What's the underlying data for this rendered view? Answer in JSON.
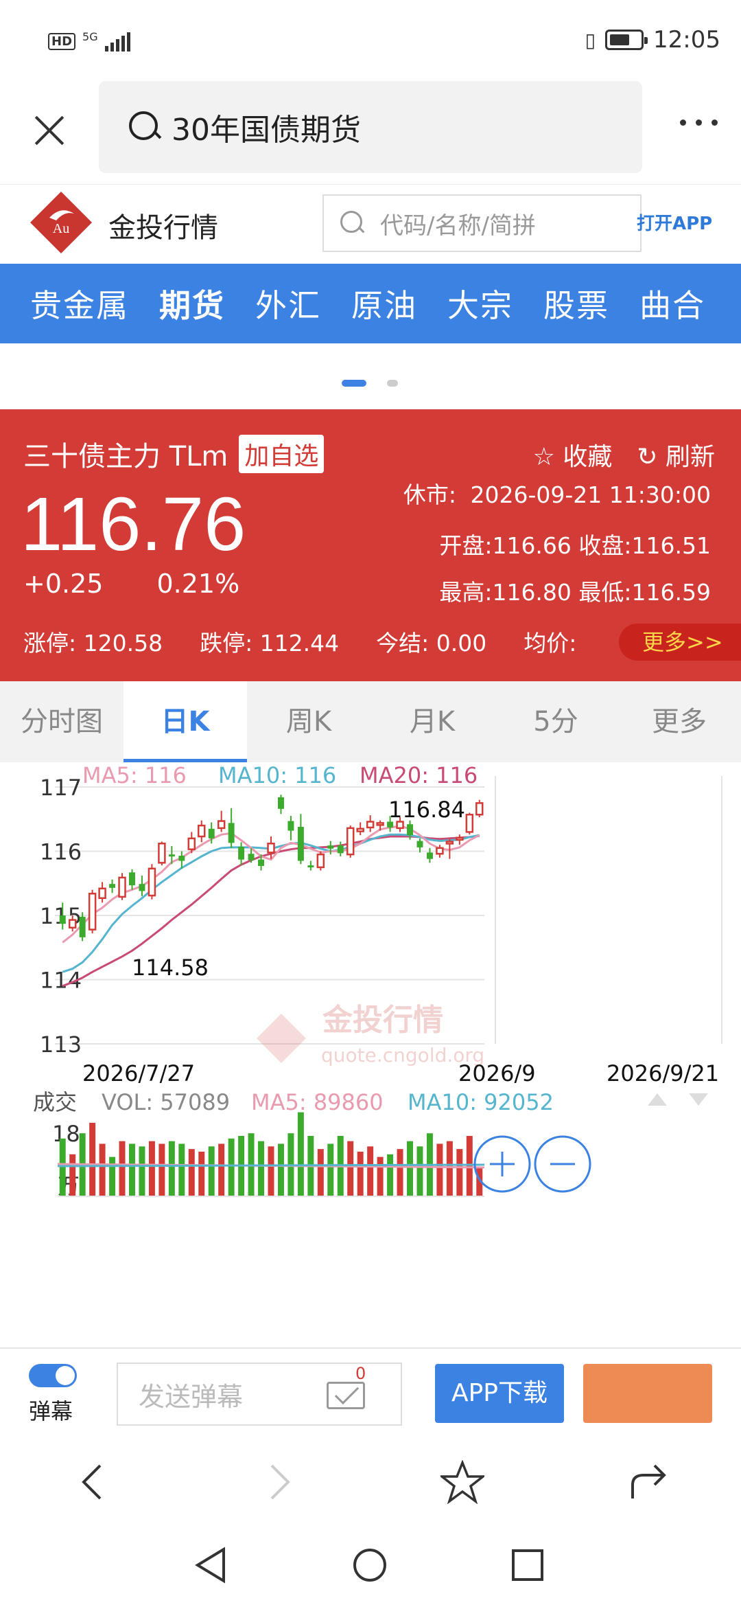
{
  "status_bar": {
    "hd": "HD",
    "network": "5G",
    "time": "12:05"
  },
  "browser": {
    "search_text": "30年国债期货"
  },
  "site": {
    "name": "金投行情",
    "logo_text": "Au",
    "search_placeholder": "代码/名称/简拼",
    "open_app": "打开APP"
  },
  "nav": [
    "贵金属",
    "期货",
    "外汇",
    "原油",
    "大宗",
    "股票",
    "曲合"
  ],
  "quote": {
    "name": "三十债主力 TLm",
    "add_watch": "加自选",
    "favorite": "收藏",
    "refresh": "刷新",
    "price": "116.76",
    "change": "+0.25",
    "change_pct": "0.21%",
    "status_label": "休市:",
    "status_time": "2026-09-21 11:30:00",
    "open_close": "开盘:116.66 收盘:116.51",
    "high_low": "最高:116.80 最低:116.59",
    "limit_up": "涨停: 120.58",
    "limit_down": "跌停: 112.44",
    "settle": "今结: 0.00",
    "avg": "均价:",
    "more": "更多>>"
  },
  "tabs": [
    "分时图",
    "日K",
    "周K",
    "月K",
    "5分",
    "更多"
  ],
  "colors": {
    "up": "#d23b36",
    "down": "#3cab2d",
    "ma5": "#ea9aaf",
    "ma10": "#55b5cf",
    "ma20": "#c94a72",
    "accent": "#3c82e3"
  },
  "chart_data": {
    "type": "candlestick",
    "ma_legend": [
      "MA5: 116",
      "MA10: 116",
      "MA20: 116"
    ],
    "y_ticks": [
      "117",
      "116",
      "115",
      "114",
      "113"
    ],
    "ylim": [
      113,
      117.1
    ],
    "x_labels": [
      "2026/7/27",
      "2026/9",
      "2026/9/21"
    ],
    "max_label": "116.84",
    "min_label": "114.58",
    "watermark_name": "金投行情",
    "watermark_url": "quote.cngold.org",
    "volume_legend": {
      "label": "成交",
      "vol": "VOL: 57089",
      "ma5": "MA5: 89860",
      "ma10": "MA10: 92052"
    },
    "volume_unit_top": "18",
    "volume_unit_bottom": "万",
    "candles": [
      [
        114.87,
        115.0,
        114.78,
        115.2,
        "down"
      ],
      [
        114.81,
        114.93,
        114.75,
        115.0,
        "up"
      ],
      [
        114.98,
        114.66,
        114.6,
        115.05,
        "down"
      ],
      [
        114.78,
        115.34,
        114.72,
        115.4,
        "up"
      ],
      [
        115.27,
        115.42,
        115.2,
        115.52,
        "up"
      ],
      [
        115.49,
        115.43,
        115.35,
        115.56,
        "down"
      ],
      [
        115.29,
        115.59,
        115.24,
        115.66,
        "up"
      ],
      [
        115.67,
        115.47,
        115.4,
        115.72,
        "down"
      ],
      [
        115.49,
        115.38,
        115.3,
        115.62,
        "down"
      ],
      [
        115.31,
        115.73,
        115.25,
        115.8,
        "up"
      ],
      [
        115.82,
        116.12,
        115.78,
        116.15,
        "up"
      ],
      [
        115.95,
        115.92,
        115.8,
        116.08,
        "down"
      ],
      [
        115.93,
        115.85,
        115.73,
        116.0,
        "down"
      ],
      [
        116.03,
        116.2,
        115.97,
        116.3,
        "up"
      ],
      [
        116.23,
        116.4,
        116.14,
        116.48,
        "up"
      ],
      [
        116.35,
        116.2,
        116.12,
        116.45,
        "down"
      ],
      [
        116.36,
        116.47,
        116.3,
        116.63,
        "up"
      ],
      [
        116.44,
        116.13,
        116.05,
        116.67,
        "down"
      ],
      [
        116.07,
        115.87,
        115.78,
        116.14,
        "down"
      ],
      [
        115.96,
        115.86,
        115.82,
        116.05,
        "down"
      ],
      [
        115.87,
        115.77,
        115.7,
        115.95,
        "down"
      ],
      [
        115.98,
        116.12,
        115.88,
        116.23,
        "up"
      ],
      [
        116.84,
        116.66,
        116.58,
        116.88,
        "down"
      ],
      [
        116.47,
        116.32,
        116.17,
        116.55,
        "down"
      ],
      [
        116.38,
        115.85,
        115.8,
        116.58,
        "down"
      ],
      [
        115.78,
        115.76,
        115.7,
        115.85,
        "down"
      ],
      [
        115.75,
        115.95,
        115.7,
        116.0,
        "up"
      ],
      [
        116.09,
        116.04,
        115.95,
        116.16,
        "down"
      ],
      [
        116.09,
        115.97,
        115.92,
        116.15,
        "down"
      ],
      [
        115.95,
        116.36,
        115.9,
        116.4,
        "up"
      ],
      [
        116.31,
        116.35,
        116.25,
        116.45,
        "up"
      ],
      [
        116.37,
        116.46,
        116.3,
        116.56,
        "up"
      ],
      [
        116.41,
        116.44,
        116.32,
        116.48,
        "up"
      ],
      [
        116.46,
        116.37,
        116.3,
        116.55,
        "down"
      ],
      [
        116.36,
        116.46,
        116.3,
        116.53,
        "up"
      ],
      [
        116.42,
        116.25,
        116.18,
        116.48,
        "down"
      ],
      [
        116.16,
        116.06,
        115.98,
        116.2,
        "down"
      ],
      [
        115.98,
        115.88,
        115.82,
        116.05,
        "down"
      ],
      [
        115.96,
        116.05,
        115.9,
        116.1,
        "up"
      ],
      [
        116.14,
        116.15,
        115.88,
        116.19,
        "up"
      ],
      [
        116.2,
        116.21,
        116.1,
        116.26,
        "up"
      ],
      [
        116.3,
        116.57,
        116.26,
        116.6,
        "up"
      ],
      [
        116.57,
        116.75,
        116.53,
        116.8,
        "up"
      ]
    ],
    "ma5": [
      114.58,
      114.7,
      114.86,
      115.02,
      115.12,
      115.25,
      115.35,
      115.4,
      115.46,
      115.56,
      115.68,
      115.83,
      115.9,
      116.0,
      116.1,
      116.19,
      116.26,
      116.28,
      116.17,
      116.05,
      115.92,
      115.87,
      116.05,
      116.13,
      116.1,
      116.04,
      115.98,
      116.0,
      116.0,
      116.04,
      116.12,
      116.24,
      116.34,
      116.37,
      116.39,
      116.35,
      116.25,
      116.12,
      116.04,
      116.02,
      116.06,
      116.17,
      116.25
    ],
    "ma10": [
      114.12,
      114.17,
      114.27,
      114.43,
      114.63,
      114.85,
      115.02,
      115.15,
      115.27,
      115.4,
      115.52,
      115.63,
      115.74,
      115.83,
      115.92,
      116.0,
      116.05,
      116.06,
      116.06,
      116.06,
      116.05,
      116.04,
      116.08,
      116.12,
      116.13,
      116.09,
      116.04,
      116.0,
      116.02,
      116.07,
      116.12,
      116.18,
      116.23,
      116.26,
      116.26,
      116.25,
      116.22,
      116.18,
      116.16,
      116.17,
      116.18,
      116.22,
      116.25
    ],
    "ma20": [
      113.9,
      113.96,
      114.03,
      114.12,
      114.2,
      114.28,
      114.36,
      114.45,
      114.56,
      114.68,
      114.8,
      114.93,
      115.05,
      115.17,
      115.3,
      115.43,
      115.57,
      115.7,
      115.79,
      115.86,
      115.92,
      115.96,
      116.0,
      116.03,
      116.05,
      116.05,
      116.06,
      116.07,
      116.09,
      116.12,
      116.15,
      116.19,
      116.21,
      116.23,
      116.23,
      116.23,
      116.22,
      116.2,
      116.19,
      116.2,
      116.21,
      116.22,
      116.24
    ],
    "volume": [
      11.0,
      8.0,
      12.0,
      14.0,
      10.0,
      7.5,
      10.5,
      10.0,
      9.5,
      10.5,
      10.0,
      10.5,
      10.0,
      9.0,
      8.5,
      9.5,
      10.0,
      11.0,
      11.5,
      12.0,
      10.5,
      9.5,
      10.0,
      12.0,
      16.0,
      11.5,
      9.0,
      10.0,
      11.5,
      10.5,
      8.5,
      9.5,
      7.5,
      8.0,
      9.0,
      10.5,
      9.5,
      12.0,
      10.0,
      10.5,
      9.0,
      11.5,
      5.5
    ],
    "vol_max": 18
  },
  "actionbar": {
    "danmu_label": "弹幕",
    "danmu_placeholder": "发送弹幕",
    "msg_count": "0",
    "app_download": "APP下载"
  }
}
